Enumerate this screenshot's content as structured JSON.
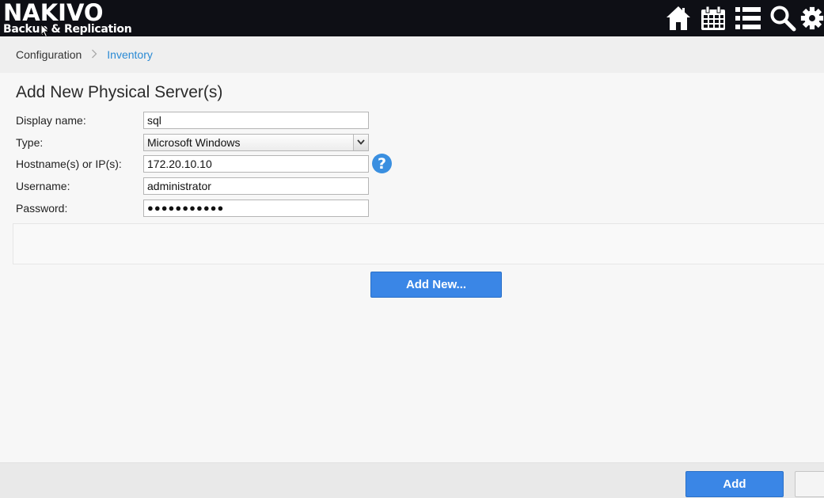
{
  "header": {
    "brand": "NAKIVO",
    "subtitle": "Backup & Replication",
    "icons": [
      "home-icon",
      "calendar-icon",
      "list-icon",
      "search-icon",
      "gear-icon"
    ]
  },
  "breadcrumb": {
    "root": "Configuration",
    "separator": ">",
    "current": "Inventory"
  },
  "form": {
    "title": "Add New Physical Server(s)",
    "display_name_label": "Display name:",
    "display_name_value": "sql",
    "type_label": "Type:",
    "type_value": "Microsoft Windows",
    "hostname_label": "Hostname(s) or IP(s):",
    "hostname_value": "172.20.10.10",
    "username_label": "Username:",
    "username_value": "administrator",
    "password_label": "Password:",
    "password_value": "●●●●●●●●●●●",
    "help_symbol": "?"
  },
  "actions": {
    "add_new_label": "Add New...",
    "add_label": "Add",
    "secondary_label": ""
  },
  "colors": {
    "topbar": "#0e0f15",
    "accent": "#3a86e6",
    "link": "#2a8ad4"
  }
}
